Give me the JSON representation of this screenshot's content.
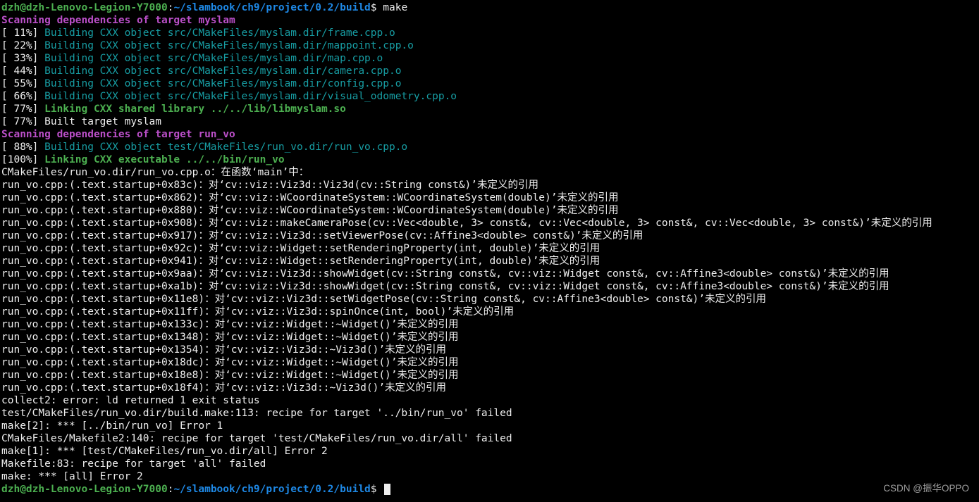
{
  "prompt": {
    "user": "dzh@dzh-Lenovo-Legion-Y7000",
    "sep": ":",
    "path": "~/slambook/ch9/project/0.2/build",
    "sign": "$",
    "cmd": "make"
  },
  "scan1": "Scanning dependencies of target myslam",
  "build": [
    {
      "pct": "[ 11%] ",
      "txt": "Building CXX object src/CMakeFiles/myslam.dir/frame.cpp.o"
    },
    {
      "pct": "[ 22%] ",
      "txt": "Building CXX object src/CMakeFiles/myslam.dir/mappoint.cpp.o"
    },
    {
      "pct": "[ 33%] ",
      "txt": "Building CXX object src/CMakeFiles/myslam.dir/map.cpp.o"
    },
    {
      "pct": "[ 44%] ",
      "txt": "Building CXX object src/CMakeFiles/myslam.dir/camera.cpp.o"
    },
    {
      "pct": "[ 55%] ",
      "txt": "Building CXX object src/CMakeFiles/myslam.dir/config.cpp.o"
    },
    {
      "pct": "[ 66%] ",
      "txt": "Building CXX object src/CMakeFiles/myslam.dir/visual_odometry.cpp.o"
    }
  ],
  "link1_pct": "[ 77%] ",
  "link1_txt": "Linking CXX shared library ../../lib/libmyslam.so",
  "built1": "[ 77%] Built target myslam",
  "scan2": "Scanning dependencies of target run_vo",
  "build2_pct": "[ 88%] ",
  "build2_txt": "Building CXX object test/CMakeFiles/run_vo.dir/run_vo.cpp.o",
  "link2_pct": "[100%] ",
  "link2_txt": "Linking CXX executable ../../bin/run_vo",
  "errors": [
    "CMakeFiles/run_vo.dir/run_vo.cpp.o：在函数‘main’中：",
    "run_vo.cpp:(.text.startup+0x83c)：对‘cv::viz::Viz3d::Viz3d(cv::String const&)’未定义的引用",
    "run_vo.cpp:(.text.startup+0x862)：对‘cv::viz::WCoordinateSystem::WCoordinateSystem(double)’未定义的引用",
    "run_vo.cpp:(.text.startup+0x880)：对‘cv::viz::WCoordinateSystem::WCoordinateSystem(double)’未定义的引用",
    "run_vo.cpp:(.text.startup+0x908)：对‘cv::viz::makeCameraPose(cv::Vec<double, 3> const&, cv::Vec<double, 3> const&, cv::Vec<double, 3> const&)’未定义的引用",
    "run_vo.cpp:(.text.startup+0x917)：对‘cv::viz::Viz3d::setViewerPose(cv::Affine3<double> const&)’未定义的引用",
    "run_vo.cpp:(.text.startup+0x92c)：对‘cv::viz::Widget::setRenderingProperty(int, double)’未定义的引用",
    "run_vo.cpp:(.text.startup+0x941)：对‘cv::viz::Widget::setRenderingProperty(int, double)’未定义的引用",
    "run_vo.cpp:(.text.startup+0x9aa)：对‘cv::viz::Viz3d::showWidget(cv::String const&, cv::viz::Widget const&, cv::Affine3<double> const&)’未定义的引用",
    "run_vo.cpp:(.text.startup+0xa1b)：对‘cv::viz::Viz3d::showWidget(cv::String const&, cv::viz::Widget const&, cv::Affine3<double> const&)’未定义的引用",
    "run_vo.cpp:(.text.startup+0x11e8)：对‘cv::viz::Viz3d::setWidgetPose(cv::String const&, cv::Affine3<double> const&)’未定义的引用",
    "run_vo.cpp:(.text.startup+0x11ff)：对‘cv::viz::Viz3d::spinOnce(int, bool)’未定义的引用",
    "run_vo.cpp:(.text.startup+0x133c)：对‘cv::viz::Widget::~Widget()’未定义的引用",
    "run_vo.cpp:(.text.startup+0x1348)：对‘cv::viz::Widget::~Widget()’未定义的引用",
    "run_vo.cpp:(.text.startup+0x1354)：对‘cv::viz::Viz3d::~Viz3d()’未定义的引用",
    "run_vo.cpp:(.text.startup+0x18dc)：对‘cv::viz::Widget::~Widget()’未定义的引用",
    "run_vo.cpp:(.text.startup+0x18e8)：对‘cv::viz::Widget::~Widget()’未定义的引用",
    "run_vo.cpp:(.text.startup+0x18f4)：对‘cv::viz::Viz3d::~Viz3d()’未定义的引用",
    "collect2: error: ld returned 1 exit status",
    "test/CMakeFiles/run_vo.dir/build.make:113: recipe for target '../bin/run_vo' failed",
    "make[2]: *** [../bin/run_vo] Error 1",
    "CMakeFiles/Makefile2:140: recipe for target 'test/CMakeFiles/run_vo.dir/all' failed",
    "make[1]: *** [test/CMakeFiles/run_vo.dir/all] Error 2",
    "Makefile:83: recipe for target 'all' failed",
    "make: *** [all] Error 2"
  ],
  "watermark": "CSDN @振华OPPO"
}
